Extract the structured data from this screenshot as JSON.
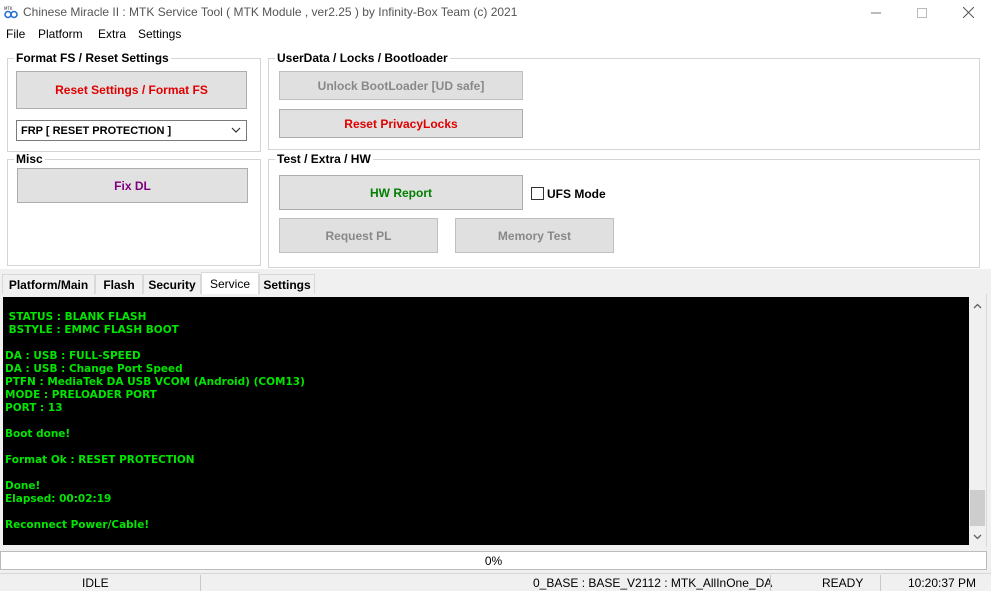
{
  "window": {
    "title": "Chinese Miracle II : MTK Service Tool ( MTK Module , ver2.25  ) by Infinity-Box Team (c) 2021",
    "controls": {
      "minimize": "—",
      "maximize": "☐",
      "close": "✕"
    }
  },
  "menu": [
    "File",
    "Platform",
    "Extra",
    "Settings"
  ],
  "groups": {
    "format": {
      "title": "Format FS / Reset Settings",
      "reset_button": "Reset Settings / Format FS",
      "combo_value": "FRP [ RESET PROTECTION ]"
    },
    "userdata": {
      "title": "UserData /  Locks  / Bootloader",
      "unlock_button": "Unlock BootLoader [UD safe]",
      "reset_privacy_button": "Reset PrivacyLocks"
    },
    "misc": {
      "title": "Misc",
      "fix_dl_button": "Fix DL"
    },
    "test": {
      "title": "Test / Extra / HW",
      "hw_report_button": "HW Report",
      "ufs_mode_label": "UFS Mode",
      "ufs_mode_checked": false,
      "request_pl_button": "Request PL",
      "memory_test_button": "Memory Test"
    }
  },
  "tabs": [
    {
      "label": "Platform/Main",
      "active": false
    },
    {
      "label": "Flash",
      "active": false
    },
    {
      "label": "Security",
      "active": false
    },
    {
      "label": "Service",
      "active": true
    },
    {
      "label": "Settings",
      "active": false
    }
  ],
  "console_lines": [
    " STATUS : BLANK FLASH",
    " BSTYLE : EMMC FLASH BOOT",
    "",
    "DA : USB : FULL-SPEED",
    "DA : USB : Change Port Speed",
    "PTFN : MediaTek DA USB VCOM (Android) (COM13)",
    "MODE : PRELOADER PORT",
    "PORT : 13",
    "",
    "Boot done!",
    "",
    "Format Ok : RESET PROTECTION",
    "",
    "Done!",
    "Elapsed: 00:02:19",
    "",
    "Reconnect Power/Cable!"
  ],
  "progress": {
    "percent": 0,
    "label": "0%"
  },
  "status": {
    "state": "IDLE",
    "base": "0_BASE : BASE_V2112 : MTK_AllInOne_DA",
    "ready": "READY",
    "time": "10:20:37 PM"
  },
  "colors": {
    "console_bg": "#000000",
    "console_text": "#00e600",
    "reset_text": "#e00000",
    "fix_dl_text": "#800080",
    "hw_report_text": "#008000"
  }
}
